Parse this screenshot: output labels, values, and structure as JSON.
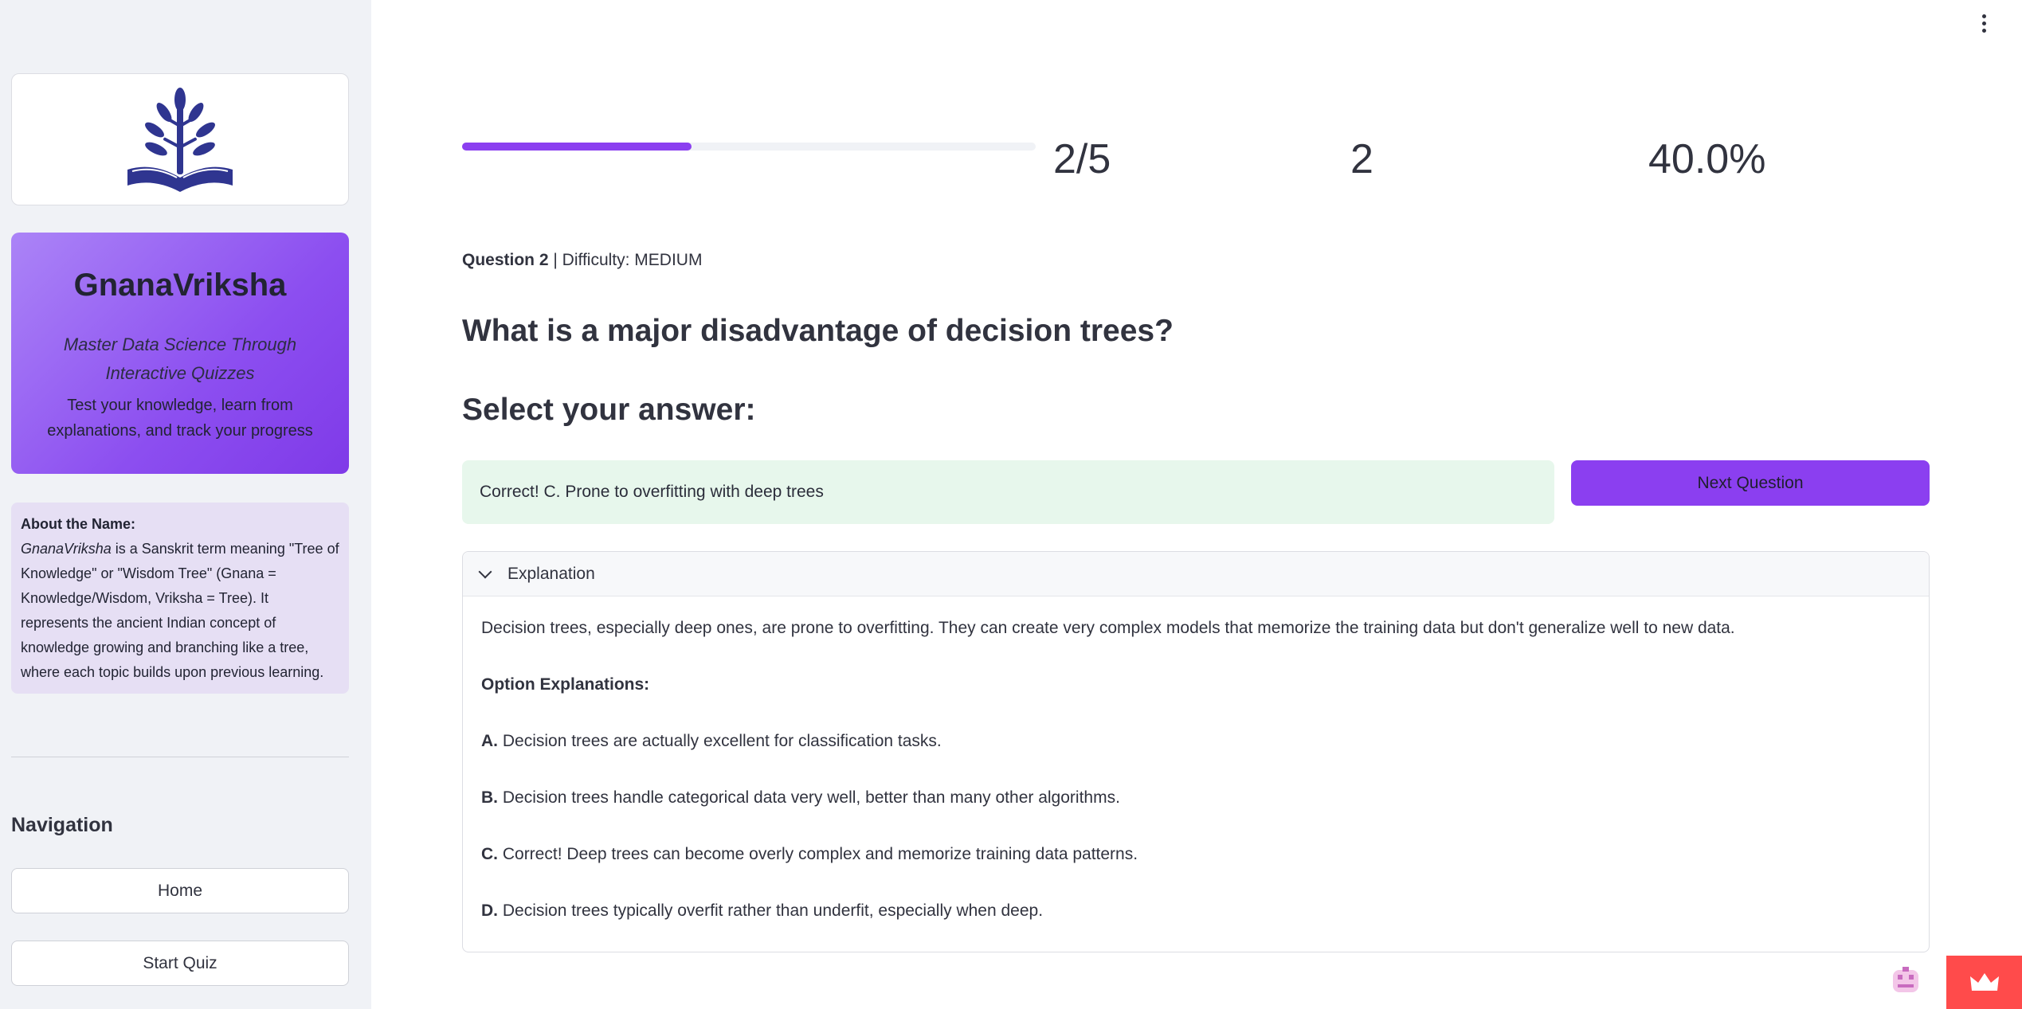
{
  "sidebar": {
    "brand": {
      "title": "GnanaVriksha",
      "tagline": "Master Data Science Through Interactive Quizzes",
      "description": "Test your knowledge, learn from explanations, and track your progress"
    },
    "about": {
      "heading": "About the Name:",
      "term": "GnanaVriksha",
      "text": " is a Sanskrit term meaning \"Tree of Knowledge\" or \"Wisdom Tree\" (Gnana = Knowledge/Wisdom, Vriksha = Tree). It represents the ancient Indian concept of knowledge growing and branching like a tree, where each topic builds upon previous learning."
    },
    "navigation": {
      "title": "Navigation",
      "items": [
        {
          "label": "Home"
        },
        {
          "label": "Start Quiz"
        }
      ]
    }
  },
  "progress": {
    "fraction": 0.4,
    "question_count": "2/5",
    "score": "2",
    "percent": "40.0%"
  },
  "question": {
    "number_label": "Question 2",
    "separator": " | ",
    "difficulty": "Difficulty: MEDIUM",
    "text": "What is a major disadvantage of decision trees?",
    "select_prompt": "Select your answer:"
  },
  "feedback": {
    "message": "Correct! C. Prone to overfitting with deep trees",
    "next_button": "Next Question"
  },
  "explanation": {
    "title": "Explanation",
    "summary": "Decision trees, especially deep ones, are prone to overfitting. They can create very complex models that memorize the training data but don't generalize well to new data.",
    "options_heading": "Option Explanations:",
    "options": [
      {
        "key": "A.",
        "text": "Decision trees are actually excellent for classification tasks."
      },
      {
        "key": "B.",
        "text": "Decision trees handle categorical data very well, better than many other algorithms."
      },
      {
        "key": "C.",
        "text": "Correct! Deep trees can become overly complex and memorize training data patterns."
      },
      {
        "key": "D.",
        "text": "Decision trees typically overfit rather than underfit, especially when deep."
      }
    ]
  },
  "colors": {
    "accent": "#8b3ff0",
    "success_bg": "#e7f7ec",
    "sidebar_bg": "#f0f2f6",
    "logo": "#2f3590",
    "deploy_red": "#ff4b4b"
  },
  "icons": {
    "logo": "tree-book-logo",
    "menu": "vertical-dots-icon",
    "chevron": "chevron-down-icon",
    "crown": "crown-icon",
    "avatar": "avatar-icon"
  }
}
